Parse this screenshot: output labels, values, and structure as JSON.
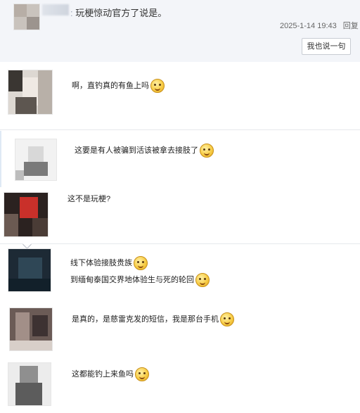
{
  "thread": {
    "reply_user": "▒▒▒▒▒▒▒▒▒▒",
    "reply_suffix": ":",
    "reply_text": "玩梗惊动官方了说是。",
    "timestamp": "2025-1-14 19:43",
    "reply_label": "回复",
    "say_button": "我也说一句"
  },
  "comments": [
    {
      "text": "啊，直钓真的有鱼上吗",
      "emojis": 1
    },
    {
      "text": "这要是有人被骗到活该被拿去接肢了",
      "emojis": 1
    },
    {
      "text": "这不是玩梗?",
      "emojis": 0
    },
    {
      "text": "线下体验接肢贵族",
      "emojis": 1
    },
    {
      "text": "到缅甸泰国交界地体验生与死的轮回",
      "emojis": 1
    },
    {
      "text": "是真的，是慈雷克发的短信，我是那台手机",
      "emojis": 1
    },
    {
      "text": "这都能钓上来鱼吗",
      "emojis": 1
    }
  ],
  "icons": {
    "emoji": "smiley-emoji-icon",
    "avatar": "blurred-avatar"
  },
  "colors": {
    "top_bg": "#f3f5f9",
    "button_border": "#c8ccd3",
    "divider": "#e6e8ec"
  }
}
